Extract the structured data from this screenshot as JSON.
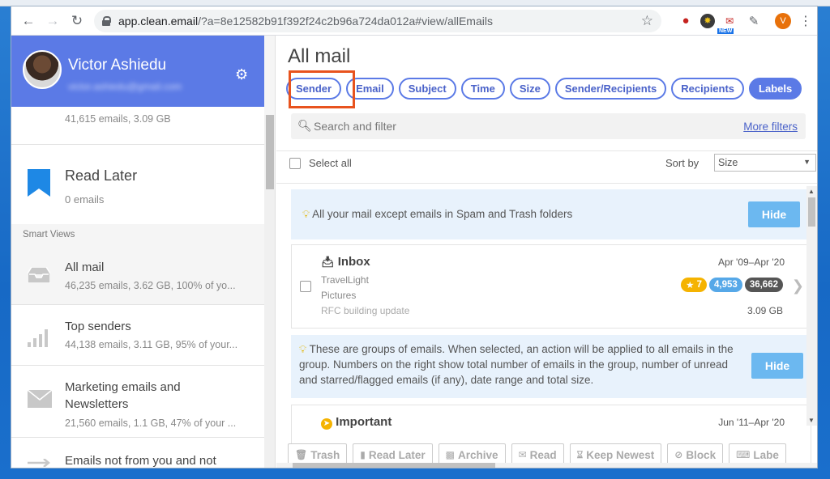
{
  "browser": {
    "url_host": "app.clean.email",
    "url_rest": "/?a=8e12582b91f392f24c2b96a724da012a#view/allEmails",
    "ext_new_badge": "NEW",
    "profile_initial": "V"
  },
  "profile": {
    "name": "Victor Ashiedu",
    "email": "victor.ashiedu@gmail.com",
    "top_stats": "41,615 emails, 3.09 GB"
  },
  "sidebar": {
    "read_later": {
      "title": "Read Later",
      "sub": "0 emails"
    },
    "smart_views_label": "Smart Views",
    "items": [
      {
        "title": "All mail",
        "sub": "46,235 emails, 3.62 GB, 100% of yo..."
      },
      {
        "title": "Top senders",
        "sub": "44,138 emails, 3.11 GB, 95% of your..."
      },
      {
        "title": "Marketing emails and",
        "title2": "Newsletters",
        "sub": "21,560 emails, 1.1 GB, 47% of your ..."
      },
      {
        "title": "Emails not from you and not"
      }
    ]
  },
  "main": {
    "title": "All mail",
    "filters": [
      "Sender",
      "Email",
      "Subject",
      "Time",
      "Size",
      "Sender/Recipients",
      "Recipients",
      "Labels"
    ],
    "search_placeholder": "Search and filter",
    "more_filters": "More filters",
    "select_all": "Select all",
    "sort_by_label": "Sort by",
    "sort_by_value": "Size",
    "info1": "All your mail except emails in Spam and Trash folders",
    "hide_label": "Hide",
    "inbox": {
      "title": "Inbox",
      "date": "Apr '09–Apr '20",
      "lines": [
        "TravelLight",
        "Pictures",
        "RFC building update"
      ],
      "badge_star": "7",
      "badge_unread": "4,953",
      "badge_total": "36,662",
      "size": "3.09 GB"
    },
    "info2": "These are groups of emails. When selected, an action will be applied to all emails in the group. Numbers on the right show total number of emails in the group, number of unread and starred/flagged emails (if any), date range and total size.",
    "important": {
      "title": "Important",
      "date": "Jun '11–Apr '20"
    },
    "actions": [
      "Trash",
      "Read Later",
      "Archive",
      "Read",
      "Keep Newest",
      "Block",
      "Labe"
    ]
  }
}
